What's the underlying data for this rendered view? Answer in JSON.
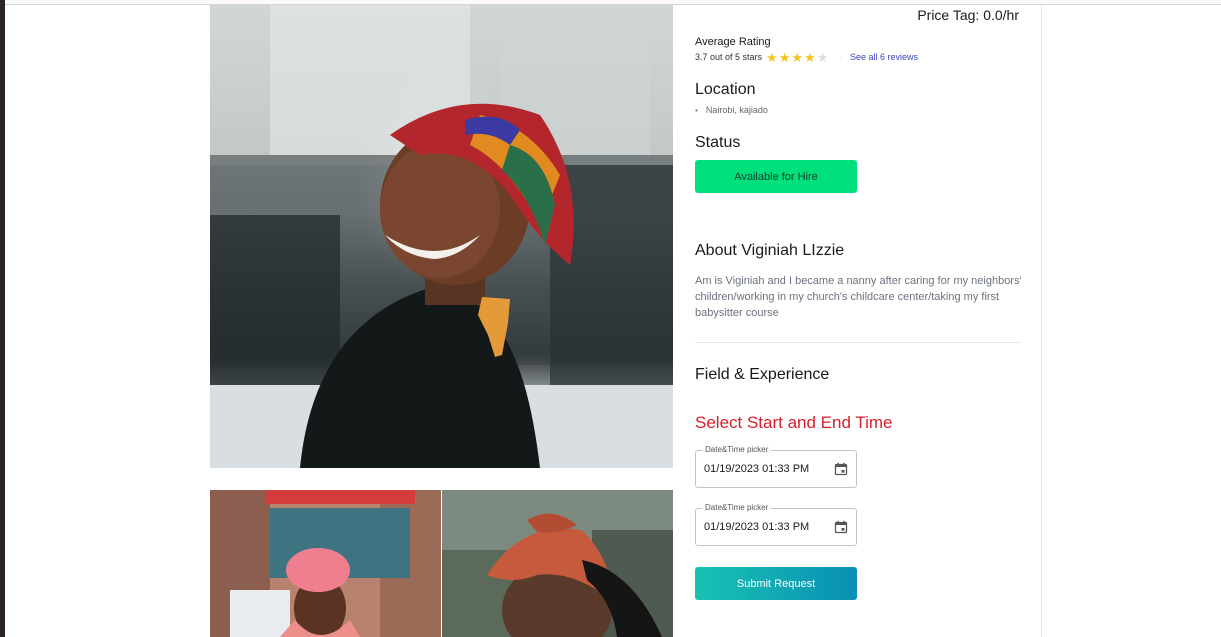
{
  "profile": {
    "price_tag": "Price Tag: 0.0/hr",
    "rating": {
      "title": "Average Rating",
      "summary": "3.7 out of 5 stars",
      "value": 3.7,
      "max": 5,
      "reviews_link": "See all 6 reviews"
    },
    "location": {
      "heading": "Location",
      "items": [
        "Nairobi, kajiado"
      ]
    },
    "status": {
      "heading": "Status",
      "button_label": "Available for Hire",
      "color": "#00e07d"
    },
    "about": {
      "heading": "About Viginiah LIzzie",
      "text": "Am is Viginiah and I became a nanny after caring for my neighbors' children/working in my church's childcare center/taking my first babysitter course"
    },
    "field_heading": "Field & Experience"
  },
  "booking": {
    "title": "Select Start and End Time",
    "title_color": "#d61f2c",
    "start": {
      "label": "Date&Time picker",
      "value": "01/19/2023 01:33 PM"
    },
    "end": {
      "label": "Date&Time picker",
      "value": "01/19/2023 01:33 PM"
    },
    "submit_label": "Submit Request"
  },
  "icons": {
    "star": "star-icon",
    "calendar": "calendar-icon"
  }
}
